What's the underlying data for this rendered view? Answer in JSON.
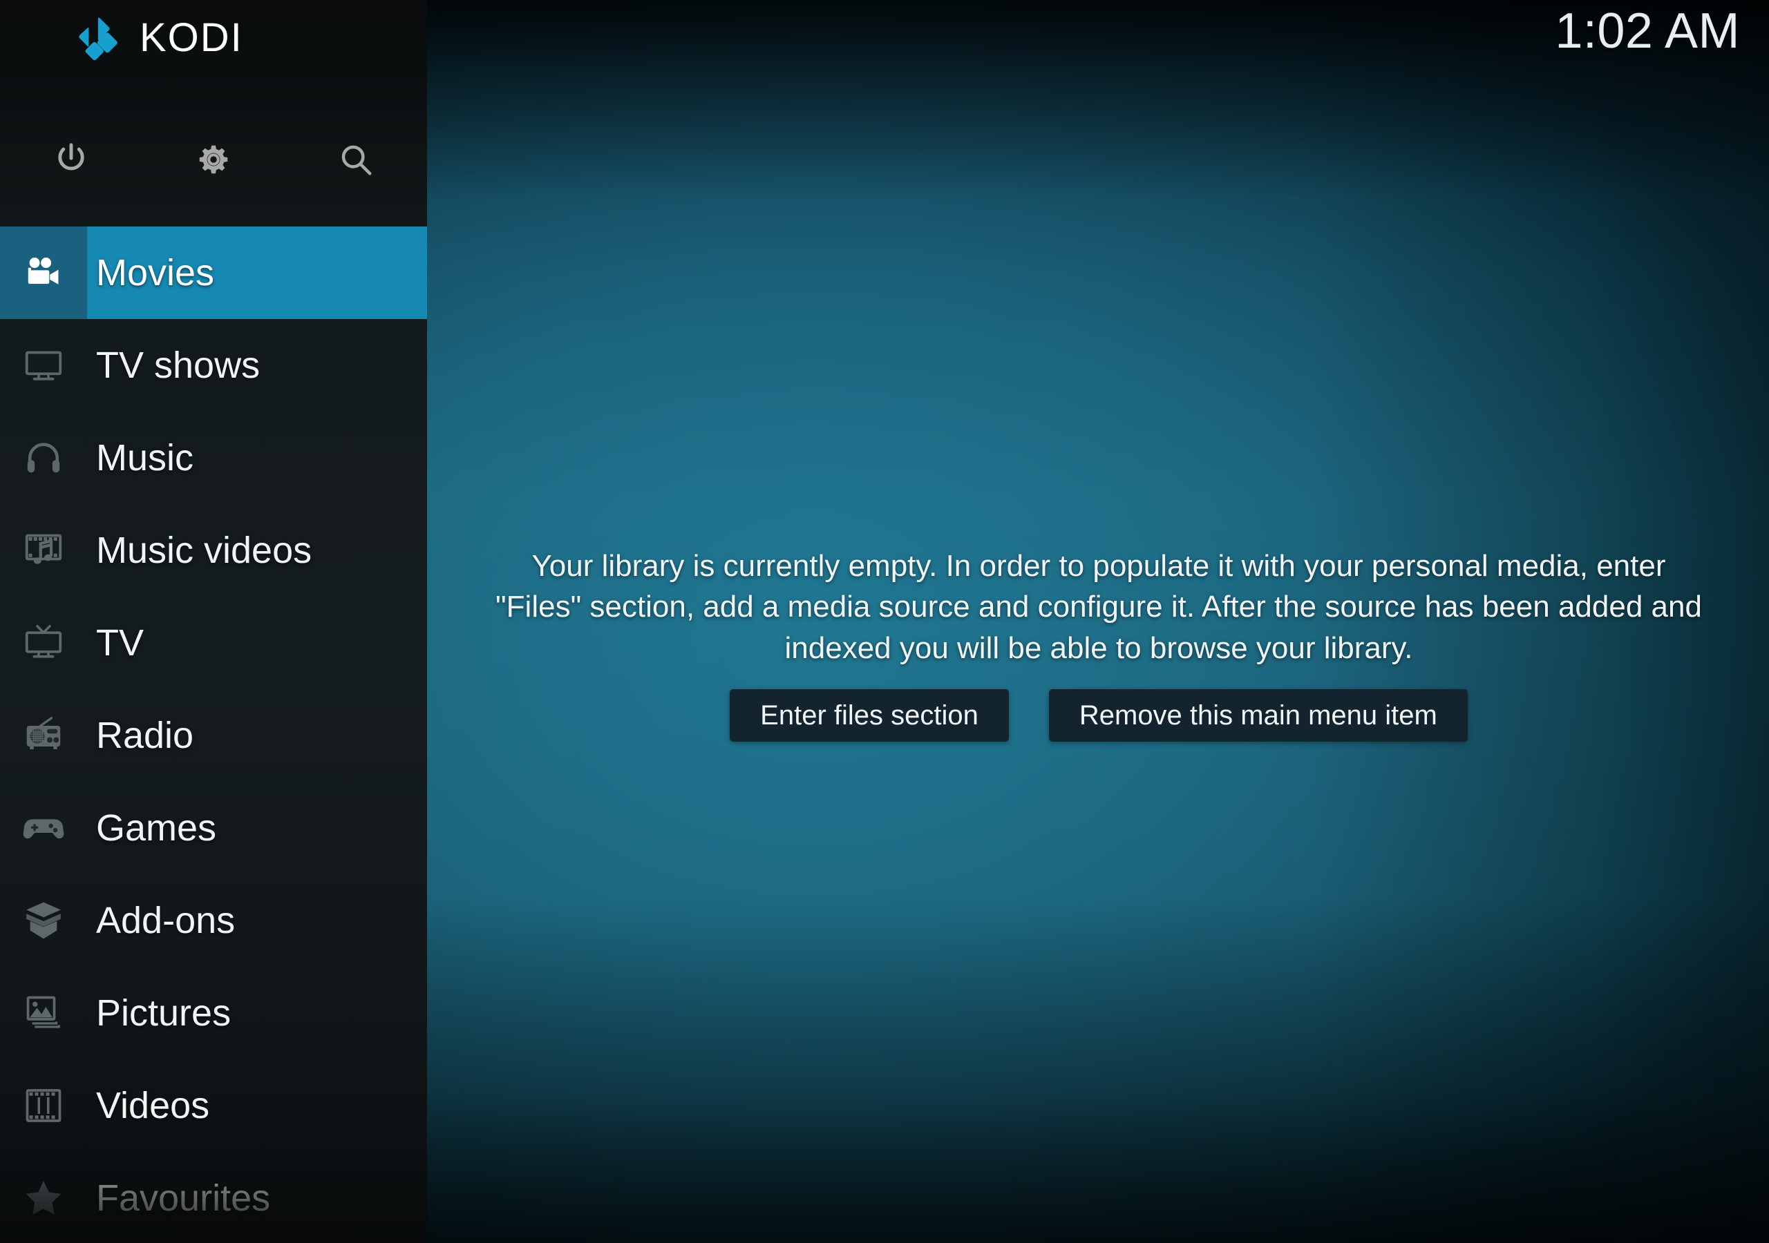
{
  "app": {
    "name": "KODI",
    "logo_color": "#17a0cf",
    "accent_color": "#1589b2",
    "accent_dark_color": "#1a6180",
    "icon_color": "#a8a8a8",
    "text_color": "#f2f5f6"
  },
  "header": {
    "clock": "1:02 AM"
  },
  "sidebar": {
    "top_icons": [
      {
        "name": "power-icon",
        "label": "Power"
      },
      {
        "name": "gear-icon",
        "label": "Settings"
      },
      {
        "name": "search-icon",
        "label": "Search"
      }
    ],
    "items": [
      {
        "label": "Movies",
        "icon": "movie-camera-icon",
        "selected": true,
        "faded": false
      },
      {
        "label": "TV shows",
        "icon": "tv-monitor-icon",
        "selected": false,
        "faded": false
      },
      {
        "label": "Music",
        "icon": "headphones-icon",
        "selected": false,
        "faded": false
      },
      {
        "label": "Music videos",
        "icon": "film-music-icon",
        "selected": false,
        "faded": false
      },
      {
        "label": "TV",
        "icon": "tv-antenna-icon",
        "selected": false,
        "faded": false
      },
      {
        "label": "Radio",
        "icon": "radio-icon",
        "selected": false,
        "faded": false
      },
      {
        "label": "Games",
        "icon": "gamepad-icon",
        "selected": false,
        "faded": false
      },
      {
        "label": "Add-ons",
        "icon": "open-box-icon",
        "selected": false,
        "faded": false
      },
      {
        "label": "Pictures",
        "icon": "photos-icon",
        "selected": false,
        "faded": false
      },
      {
        "label": "Videos",
        "icon": "film-strip-icon",
        "selected": false,
        "faded": false
      },
      {
        "label": "Favourites",
        "icon": "star-icon",
        "selected": false,
        "faded": true
      }
    ]
  },
  "main": {
    "empty_message": "Your library is currently empty. In order to populate it with your personal media, enter \"Files\" section, add a media source and configure it. After the source has been added and indexed you will be able to browse your library.",
    "buttons": [
      {
        "label": "Enter files section"
      },
      {
        "label": "Remove this main menu item"
      }
    ]
  }
}
